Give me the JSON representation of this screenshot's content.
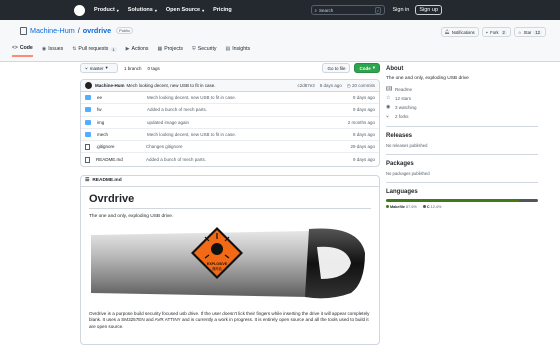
{
  "header": {
    "nav": [
      "Product",
      "Solutions",
      "Open Source",
      "Pricing"
    ],
    "search_placeholder": "Search",
    "slash_key": "/",
    "signin": "Sign in",
    "signup": "Sign up"
  },
  "repo": {
    "owner": "Machine-Hum",
    "separator": "/",
    "name": "ovrdrive",
    "visibility": "Public",
    "notifications": "Notifications",
    "fork_label": "Fork",
    "fork_count": "2",
    "star_label": "Star",
    "star_count": "12"
  },
  "tabs": [
    {
      "label": "Code",
      "icon": "<>"
    },
    {
      "label": "Issues",
      "icon": "◉",
      "count": ""
    },
    {
      "label": "Pull requests",
      "icon": "⇅",
      "count": "1"
    },
    {
      "label": "Actions",
      "icon": "▶"
    },
    {
      "label": "Projects",
      "icon": "▦"
    },
    {
      "label": "Security",
      "icon": "⛨"
    },
    {
      "label": "Insights",
      "icon": "▤"
    }
  ],
  "branch": {
    "name": "master",
    "branches": "1 branch",
    "tags": "0 tags",
    "goto_file": "Go to file",
    "code": "Code"
  },
  "commit": {
    "author": "Machine-Hum",
    "message": "Mech looking decent, new USB to fit in case.",
    "hash": "c2d87e3",
    "age": "8 days ago",
    "commits": "20 commits"
  },
  "files": [
    {
      "type": "folder",
      "name": "ee",
      "message": "Mech looking decent, new USB to fit in case.",
      "age": "8 days ago"
    },
    {
      "type": "folder",
      "name": "fw",
      "message": "Added a bunch of mech parts.",
      "age": "9 days ago"
    },
    {
      "type": "folder",
      "name": "img",
      "message": "updated image again",
      "age": "2 months ago"
    },
    {
      "type": "folder",
      "name": "mech",
      "message": "Mech looking decent, new USB to fit in case.",
      "age": "8 days ago"
    },
    {
      "type": "file",
      "name": ".gitignore",
      "message": "Changes gitignore",
      "age": "29 days ago"
    },
    {
      "type": "file",
      "name": "README.md",
      "message": "Added a bunch of mech parts.",
      "age": "9 days ago"
    }
  ],
  "readme": {
    "file": "README.md",
    "title": "Ovrdrive",
    "tagline": "The one and only, exploding USB drive.",
    "image_label": "EXPLOSIVE",
    "description": "Ovrdrive is a purpose build security focused usb drive. If the user doesn't lick their fingers while inserting the drive it will appear completely blank. It uses a SM3257EN and AVR ATTINY and is currently a work in progress. It is entirely open source and all the tools used to build it are open source."
  },
  "sidebar": {
    "about_heading": "About",
    "about_text": "The one and only, exploding USB drive",
    "items": [
      {
        "icon": "book-icon",
        "label": "Readme"
      },
      {
        "icon": "star-icon",
        "label": "12 stars"
      },
      {
        "icon": "eye-icon",
        "label": "3 watching"
      },
      {
        "icon": "fork-icon",
        "label": "2 forks"
      }
    ],
    "releases_heading": "Releases",
    "releases_note": "No releases published",
    "packages_heading": "Packages",
    "packages_note": "No packages published",
    "languages_heading": "Languages",
    "languages": [
      {
        "name": "Makefile",
        "percent": "87.6%",
        "value": 87.6,
        "color": "#427819"
      },
      {
        "name": "C",
        "percent": "12.4%",
        "value": 12.4,
        "color": "#555555"
      }
    ]
  },
  "colors": {
    "header_bg": "#24292f",
    "link": "#0969da",
    "code_button": "#2da44e",
    "folder": "#54aeff"
  }
}
